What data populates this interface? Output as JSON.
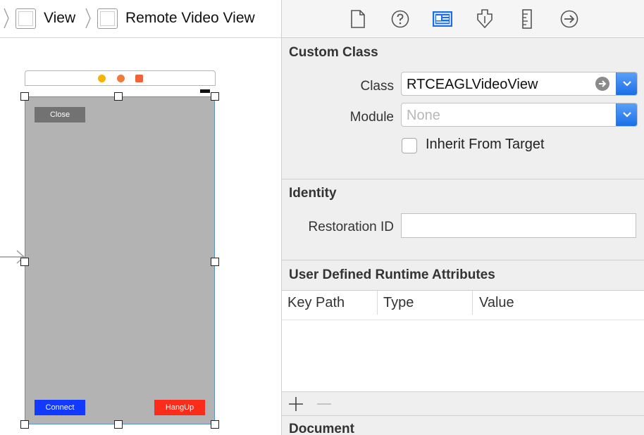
{
  "breadcrumb": {
    "items": [
      {
        "label": "View"
      },
      {
        "label": "Remote Video View"
      }
    ]
  },
  "canvas": {
    "buttons": {
      "close": "Close",
      "connect": "Connect",
      "hangup": "HangUp"
    },
    "colors": {
      "view_background": "#b3b3b3",
      "connect": "#1239ff",
      "hangup": "#fb2c1a",
      "close": "#727272",
      "selection": "#5b8fd2"
    }
  },
  "inspector": {
    "toolbar": {
      "icons": [
        "file-inspector-icon",
        "quick-help-icon",
        "identity-inspector-icon",
        "attributes-inspector-icon",
        "size-inspector-icon",
        "connections-inspector-icon"
      ],
      "selected": "identity-inspector-icon"
    },
    "custom_class": {
      "title": "Custom Class",
      "class_label": "Class",
      "class_value": "RTCEAGLVideoView",
      "module_label": "Module",
      "module_placeholder": "None",
      "inherit_label": "Inherit From Target",
      "inherit_checked": false
    },
    "identity": {
      "title": "Identity",
      "restoration_label": "Restoration ID",
      "restoration_value": ""
    },
    "runtime_attributes": {
      "title": "User Defined Runtime Attributes",
      "columns": [
        "Key Path",
        "Type",
        "Value"
      ],
      "rows": []
    },
    "document": {
      "title": "Document"
    },
    "accent_color": "#1a6ee8"
  }
}
